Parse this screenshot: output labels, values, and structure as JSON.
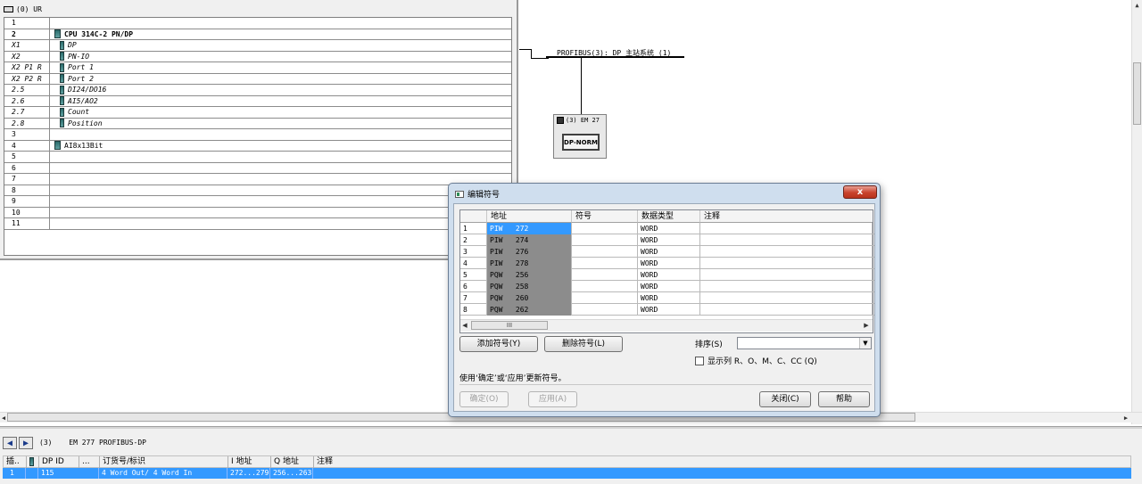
{
  "rack": {
    "title": "(0) UR",
    "rows": [
      {
        "slot": "1",
        "module": "",
        "icon": false
      },
      {
        "slot": "2",
        "module": "CPU 314C-2 PN/DP",
        "icon": true,
        "bold": true
      },
      {
        "slot": "X1",
        "module": "DP",
        "icon": true,
        "italic": true,
        "sub": true
      },
      {
        "slot": "X2",
        "module": "PN-IO",
        "icon": true,
        "italic": true,
        "sub": true
      },
      {
        "slot": "X2 P1 R",
        "module": "Port 1",
        "icon": true,
        "italic": true,
        "sub": true
      },
      {
        "slot": "X2 P2 R",
        "module": "Port 2",
        "icon": true,
        "italic": true,
        "sub": true
      },
      {
        "slot": "2.5",
        "module": "DI24/DO16",
        "icon": true,
        "italic": true,
        "sub": true
      },
      {
        "slot": "2.6",
        "module": "AI5/AO2",
        "icon": true,
        "italic": true,
        "sub": true
      },
      {
        "slot": "2.7",
        "module": "Count",
        "icon": true,
        "italic": true,
        "sub": true
      },
      {
        "slot": "2.8",
        "module": "Position",
        "icon": true,
        "italic": true,
        "sub": true
      },
      {
        "slot": "3",
        "module": "",
        "icon": false
      },
      {
        "slot": "4",
        "module": "AI8x13Bit",
        "icon": true
      },
      {
        "slot": "5",
        "module": "",
        "icon": false
      },
      {
        "slot": "6",
        "module": "",
        "icon": false
      },
      {
        "slot": "7",
        "module": "",
        "icon": false
      },
      {
        "slot": "8",
        "module": "",
        "icon": false
      },
      {
        "slot": "9",
        "module": "",
        "icon": false
      },
      {
        "slot": "10",
        "module": "",
        "icon": false
      },
      {
        "slot": "11",
        "module": "",
        "icon": false
      }
    ]
  },
  "network": {
    "bus_label": "PROFIBUS(3): DP 主站系统 (1)",
    "device_label": "(3) EM 27",
    "device_type": "DP-NORM"
  },
  "detail": {
    "station": "(3)",
    "module_name": "EM 277 PROFIBUS-DP",
    "headers": [
      "插..",
      "DP ID",
      "...",
      "订货号/标识",
      "I 地址",
      "Q 地址",
      "注释"
    ],
    "row": {
      "slot": "1",
      "dp_id": "115",
      "order": "4 Word Out/ 4 Word In",
      "i_addr": "272...279",
      "q_addr": "256...263",
      "comment": ""
    }
  },
  "dialog": {
    "title": "编辑符号",
    "close_label": "x",
    "columns": {
      "address": "地址",
      "symbol": "符号",
      "datatype": "数据类型",
      "comment": "注释"
    },
    "rows": [
      {
        "n": "1",
        "address": "PIW   272",
        "symbol": "",
        "datatype": "WORD",
        "comment": "",
        "selected": true
      },
      {
        "n": "2",
        "address": "PIW   274",
        "symbol": "",
        "datatype": "WORD",
        "comment": ""
      },
      {
        "n": "3",
        "address": "PIW   276",
        "symbol": "",
        "datatype": "WORD",
        "comment": ""
      },
      {
        "n": "4",
        "address": "PIW   278",
        "symbol": "",
        "datatype": "WORD",
        "comment": ""
      },
      {
        "n": "5",
        "address": "PQW   256",
        "symbol": "",
        "datatype": "WORD",
        "comment": ""
      },
      {
        "n": "6",
        "address": "PQW   258",
        "symbol": "",
        "datatype": "WORD",
        "comment": ""
      },
      {
        "n": "7",
        "address": "PQW   260",
        "symbol": "",
        "datatype": "WORD",
        "comment": ""
      },
      {
        "n": "8",
        "address": "PQW   262",
        "symbol": "",
        "datatype": "WORD",
        "comment": ""
      }
    ],
    "scroll_thumb_label": "III",
    "add_button": "添加符号(Y)",
    "delete_button": "删除符号(L)",
    "sort_label": "排序(S)",
    "sort_value": "",
    "show_columns_label": "显示列 R、O、M、C、CC (Q)",
    "hint": "使用‘确定’或‘应用’更新符号。",
    "ok_button": "确定(O)",
    "apply_button": "应用(A)",
    "close_button": "关闭(C)",
    "help_button": "帮助"
  },
  "colors": {
    "selection": "#3399ff",
    "dialog_frame": "#cfdeee",
    "address_cell": "#8c8c8c"
  }
}
